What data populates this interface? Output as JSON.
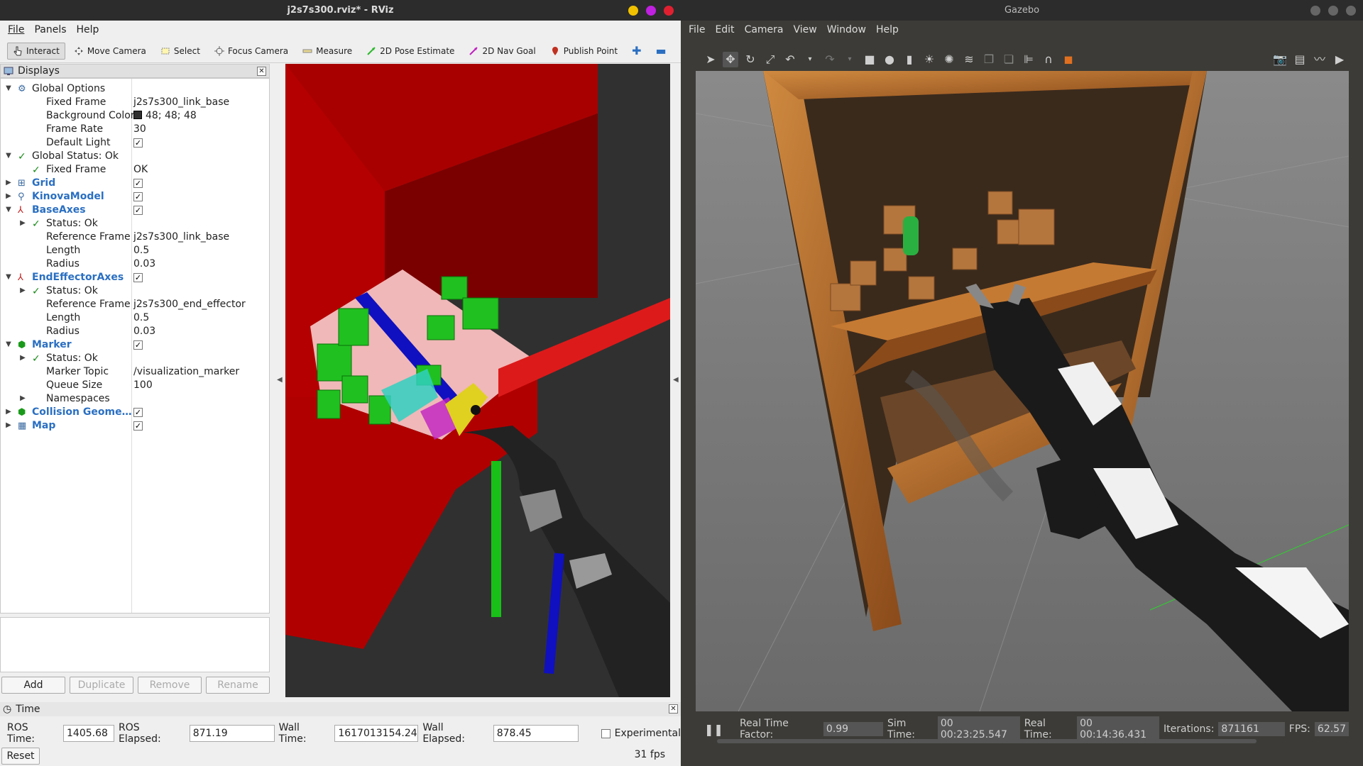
{
  "rviz": {
    "title": "j2s7s300.rviz* - RViz",
    "menu": [
      "File",
      "Panels",
      "Help"
    ],
    "tools": [
      {
        "label": "Interact",
        "icon": "interact-icon",
        "active": true
      },
      {
        "label": "Move Camera",
        "icon": "move-camera-icon"
      },
      {
        "label": "Select",
        "icon": "select-icon"
      },
      {
        "label": "Focus Camera",
        "icon": "focus-camera-icon"
      },
      {
        "label": "Measure",
        "icon": "measure-icon"
      },
      {
        "label": "2D Pose Estimate",
        "icon": "pose-estimate-icon"
      },
      {
        "label": "2D Nav Goal",
        "icon": "nav-goal-icon"
      },
      {
        "label": "Publish Point",
        "icon": "publish-point-icon"
      }
    ],
    "displays_title": "Displays",
    "tree": [
      {
        "label": "Global Options",
        "value": "",
        "indent": 0,
        "arrow": "▼",
        "icon": "gear-icon"
      },
      {
        "label": "Fixed Frame",
        "value": "j2s7s300_link_base",
        "indent": 1
      },
      {
        "label": "Background Color",
        "value": "48; 48; 48",
        "indent": 1,
        "swatch": "#303030"
      },
      {
        "label": "Frame Rate",
        "value": "30",
        "indent": 1
      },
      {
        "label": "Default Light",
        "value": "",
        "indent": 1,
        "checkbox": true
      },
      {
        "label": "Global Status: Ok",
        "value": "",
        "indent": 0,
        "arrow": "▼",
        "check": true
      },
      {
        "label": "Fixed Frame",
        "value": "OK",
        "indent": 1,
        "check": true
      },
      {
        "label": "Grid",
        "value": "",
        "indent": 0,
        "arrow": "▶",
        "blue": true,
        "icon": "grid-icon",
        "checkbox": true
      },
      {
        "label": "KinovaModel",
        "value": "",
        "indent": 0,
        "arrow": "▶",
        "blue": true,
        "icon": "robot-model-icon",
        "checkbox": true
      },
      {
        "label": "BaseAxes",
        "value": "",
        "indent": 0,
        "arrow": "▼",
        "blue": true,
        "icon": "axes-icon",
        "checkbox": true
      },
      {
        "label": "Status: Ok",
        "value": "",
        "indent": 1,
        "arrow": "▶",
        "check": true
      },
      {
        "label": "Reference Frame",
        "value": "j2s7s300_link_base",
        "indent": 1
      },
      {
        "label": "Length",
        "value": "0.5",
        "indent": 1
      },
      {
        "label": "Radius",
        "value": "0.03",
        "indent": 1
      },
      {
        "label": "EndEffectorAxes",
        "value": "",
        "indent": 0,
        "arrow": "▼",
        "blue": true,
        "icon": "axes-icon",
        "checkbox": true
      },
      {
        "label": "Status: Ok",
        "value": "",
        "indent": 1,
        "arrow": "▶",
        "check": true
      },
      {
        "label": "Reference Frame",
        "value": "j2s7s300_end_effector",
        "indent": 1
      },
      {
        "label": "Length",
        "value": "0.5",
        "indent": 1
      },
      {
        "label": "Radius",
        "value": "0.03",
        "indent": 1
      },
      {
        "label": "Marker",
        "value": "",
        "indent": 0,
        "arrow": "▼",
        "blue": true,
        "icon": "marker-icon",
        "checkbox": true
      },
      {
        "label": "Status: Ok",
        "value": "",
        "indent": 1,
        "arrow": "▶",
        "check": true
      },
      {
        "label": "Marker Topic",
        "value": "/visualization_marker",
        "indent": 1
      },
      {
        "label": "Queue Size",
        "value": "100",
        "indent": 1
      },
      {
        "label": "Namespaces",
        "value": "",
        "indent": 1,
        "arrow": "▶"
      },
      {
        "label": "Collision Geome…",
        "value": "",
        "indent": 0,
        "arrow": "▶",
        "blue": true,
        "icon": "marker-icon",
        "checkbox": true
      },
      {
        "label": "Map",
        "value": "",
        "indent": 0,
        "arrow": "▶",
        "blue": true,
        "icon": "map-icon",
        "checkbox": true
      }
    ],
    "buttons": {
      "add": "Add",
      "duplicate": "Duplicate",
      "remove": "Remove",
      "rename": "Rename"
    },
    "time": {
      "title": "Time",
      "ros_time_label": "ROS Time:",
      "ros_time": "1405.68",
      "ros_elapsed_label": "ROS Elapsed:",
      "ros_elapsed": "871.19",
      "wall_time_label": "Wall Time:",
      "wall_time": "1617013154.24",
      "wall_elapsed_label": "Wall Elapsed:",
      "wall_elapsed": "878.45",
      "experimental": "Experimental",
      "reset": "Reset",
      "fps": "31 fps"
    }
  },
  "gazebo": {
    "title": "Gazebo",
    "menu": [
      "File",
      "Edit",
      "Camera",
      "View",
      "Window",
      "Help"
    ],
    "status": {
      "rtf_label": "Real Time Factor:",
      "rtf": "0.99",
      "sim_label": "Sim Time:",
      "sim": "00 00:23:25.547",
      "real_label": "Real Time:",
      "real": "00 00:14:36.431",
      "iter_label": "Iterations:",
      "iter": "871161",
      "fps_label": "FPS:",
      "fps": "62.57"
    }
  },
  "colors": {
    "accent_blue": "#2a6fc2",
    "rviz_bg": "#303030",
    "shelf_red": "#c00000"
  }
}
